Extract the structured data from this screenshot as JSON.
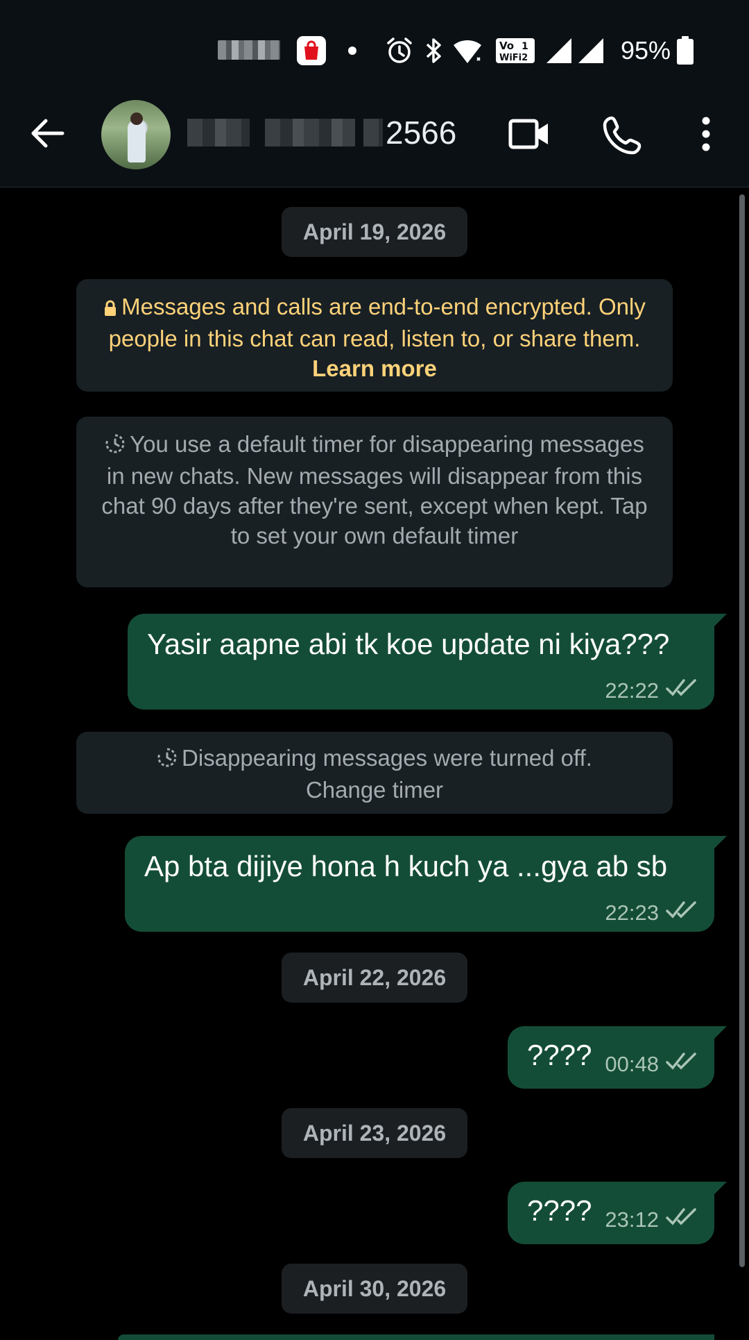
{
  "status_bar": {
    "battery_percent": "95%",
    "icons": [
      "shopping-bag-icon",
      "notification-dot-icon",
      "alarm-icon",
      "bluetooth-icon",
      "wifi-icon",
      "volte-icon",
      "signal-icon",
      "battery-icon"
    ]
  },
  "header": {
    "contact_visible_suffix": "2566",
    "icons": [
      "back-arrow-icon",
      "video-call-icon",
      "voice-call-icon",
      "more-options-icon"
    ]
  },
  "chat": {
    "date_1": "April 19, 2026",
    "encryption_notice_prefix": "Messages and calls are end-to-end encrypted. Only people in this chat can read, listen to, or share them.",
    "encryption_learn_more": "Learn more",
    "timer_notice": "You use a default timer for disappearing messages in new chats. New messages will disappear from this chat 90 days after they're sent, except when kept. Tap to set your own default timer",
    "messages": [
      {
        "text": "Yasir aapne abi tk koe update ni kiya???",
        "time": "22:22"
      },
      {
        "text": "Ap bta dijiye hona h kuch ya ...gya ab sb",
        "time": "22:23"
      },
      {
        "text": "????",
        "time": "00:48"
      },
      {
        "text": "????",
        "time": "23:12"
      }
    ],
    "disappearing_off_notice": "Disappearing messages were turned off.",
    "change_timer": "Change timer",
    "date_2": "April 22, 2026",
    "date_3": "April 23, 2026",
    "date_4": "April 30, 2026"
  },
  "colors": {
    "header_bg": "#0b1014",
    "outgoing_bubble": "#144d37",
    "system_bubble": "#182024",
    "encryption_text": "#ffd279",
    "read_tick": "#aac5b7"
  }
}
